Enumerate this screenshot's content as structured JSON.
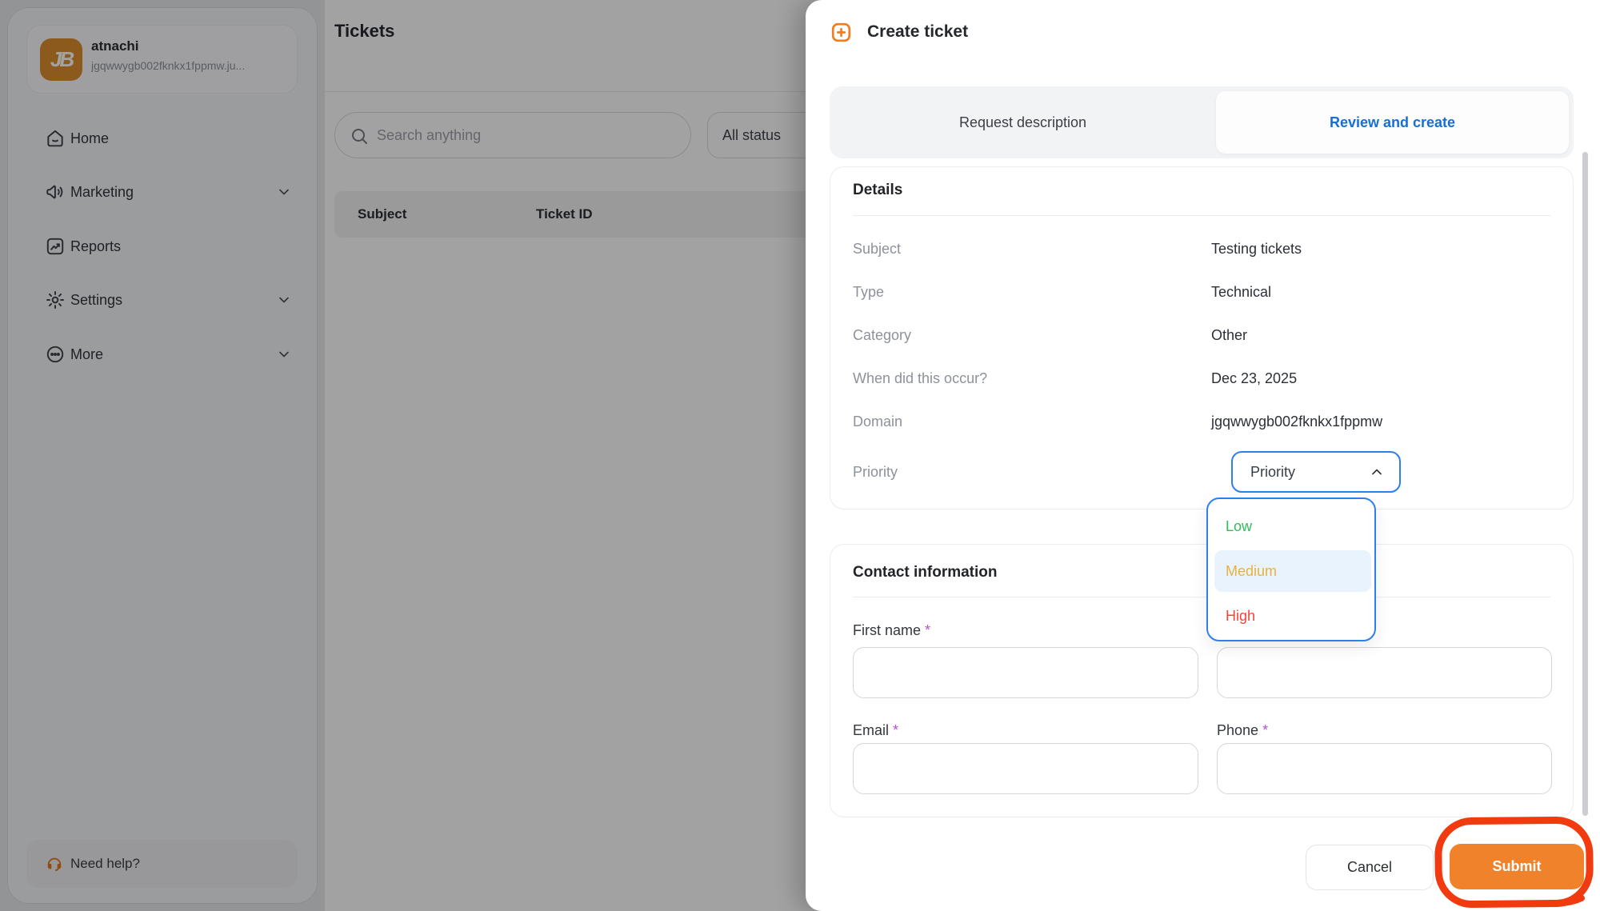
{
  "sidebar": {
    "logo_text": "JB",
    "account_name": "atnachi",
    "account_domain": "jgqwwygb002fknkx1fppmw.ju...",
    "items": [
      {
        "label": "Home"
      },
      {
        "label": "Marketing"
      },
      {
        "label": "Reports"
      },
      {
        "label": "Settings"
      },
      {
        "label": "More"
      }
    ],
    "help_label": "Need help?"
  },
  "main": {
    "title": "Tickets",
    "search_placeholder": "Search anything",
    "status_filter_label": "All status",
    "table": {
      "headers": [
        "Subject",
        "Ticket ID"
      ]
    }
  },
  "modal": {
    "title": "Create ticket",
    "tabs": {
      "inactive": "Request description",
      "active": "Review and create"
    },
    "details": {
      "heading": "Details",
      "rows": [
        {
          "label": "Subject",
          "value": "Testing tickets"
        },
        {
          "label": "Type",
          "value": "Technical"
        },
        {
          "label": "Category",
          "value": "Other"
        },
        {
          "label": "When did this occur?",
          "value": "Dec 23, 2025"
        },
        {
          "label": "Domain",
          "value": "jgqwwygb002fknkx1fppmw"
        }
      ],
      "priority": {
        "label": "Priority",
        "button_text": "Priority",
        "options": [
          {
            "label": "Low"
          },
          {
            "label": "Medium"
          },
          {
            "label": "High"
          }
        ],
        "highlighted_option": "Medium"
      }
    },
    "contact": {
      "heading": "Contact information",
      "required_marker": "*",
      "fields": [
        {
          "label": "First name",
          "required": true
        },
        {
          "label": "Email",
          "required": true
        },
        {
          "label": "Phone",
          "required": true
        }
      ]
    },
    "footer": {
      "cancel_label": "Cancel",
      "submit_label": "Submit"
    }
  },
  "colors": {
    "accent_orange": "#f0822b",
    "logo_orange": "#dd8b28",
    "annotation_red": "#f23a10",
    "active_tab_blue": "#176fd4",
    "dropdown_border_blue": "#2d80ec",
    "priority_low_green": "#2ebd59",
    "priority_medium_amber": "#e7b33c",
    "priority_medium_highlight": "#e9f3fd",
    "priority_high_red": "#f64439",
    "required_asterisk_purple": "#b452d6"
  }
}
